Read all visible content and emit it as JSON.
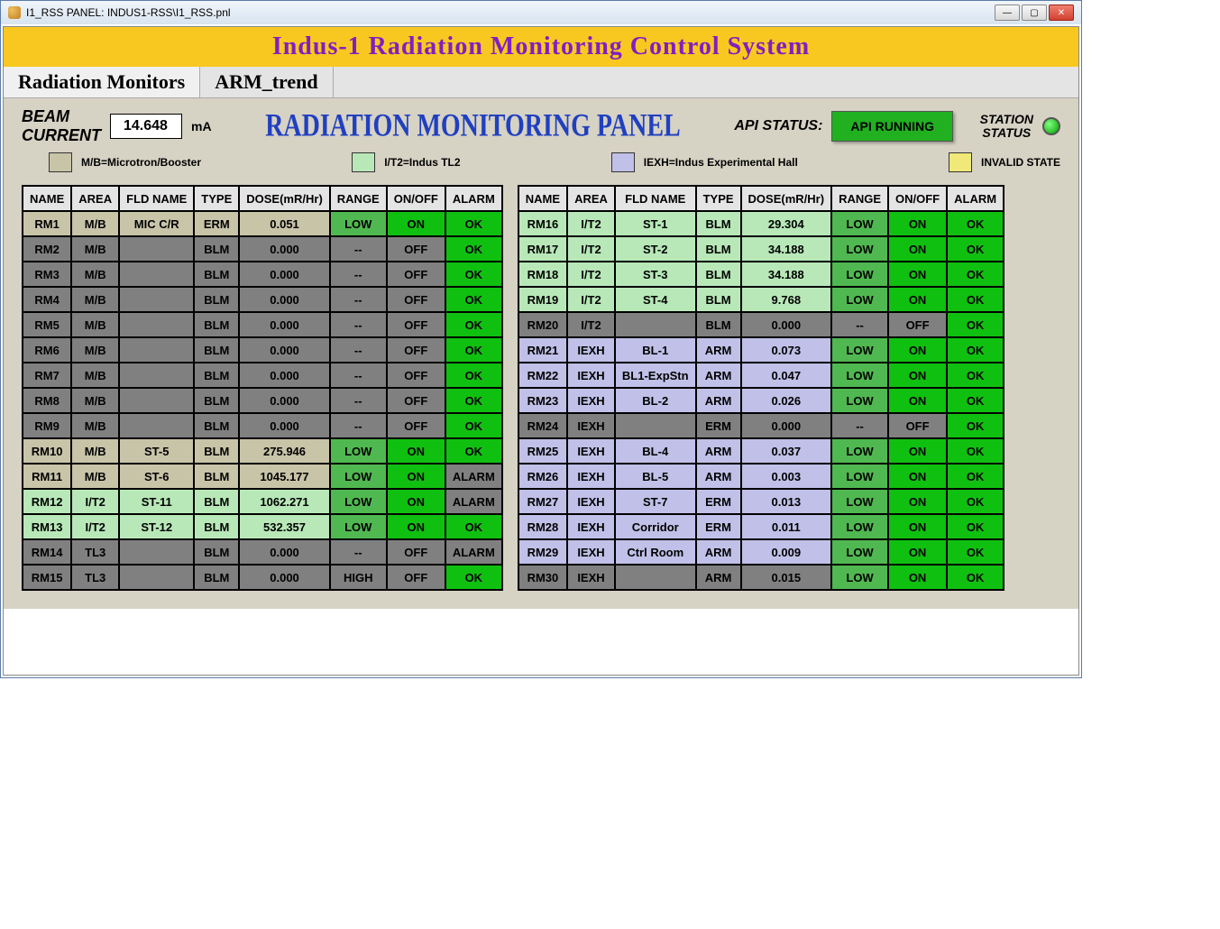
{
  "window": {
    "title": "I1_RSS PANEL: INDUS1-RSS\\I1_RSS.pnl"
  },
  "banner": "Indus-1 Radiation Monitoring Control System",
  "tabs": {
    "t0": "Radiation Monitors",
    "t1": "ARM_trend"
  },
  "top": {
    "beam_label_1": "BEAM",
    "beam_label_2": "CURRENT",
    "beam_value": "14.648",
    "beam_unit": "mA",
    "panel_title": "RADIATION MONITORING PANEL",
    "api_label": "API  STATUS:",
    "api_value": "API RUNNING",
    "station_label_1": "STATION",
    "station_label_2": "STATUS"
  },
  "legend": {
    "mb": "M/B=Microtron/Booster",
    "it2": "I/T2=Indus TL2",
    "iexh": "IEXH=Indus Experimental Hall",
    "invalid": "INVALID STATE"
  },
  "headers": {
    "name": "NAME",
    "area": "AREA",
    "fld": "FLD NAME",
    "type": "TYPE",
    "dose": "DOSE(mR/Hr)",
    "range": "RANGE",
    "onoff": "ON/OFF",
    "alarm": "ALARM"
  },
  "left": [
    {
      "name": "RM1",
      "area": "M/B",
      "ac": "mb",
      "fld": "MIC C/R",
      "type": "ERM",
      "dose": "0.051",
      "range": "LOW",
      "onoff": "ON",
      "alarm": "OK"
    },
    {
      "name": "RM2",
      "area": "M/B",
      "ac": "mb",
      "fld": "",
      "type": "BLM",
      "dose": "0.000",
      "range": "--",
      "onoff": "OFF",
      "alarm": "OK"
    },
    {
      "name": "RM3",
      "area": "M/B",
      "ac": "mb",
      "fld": "",
      "type": "BLM",
      "dose": "0.000",
      "range": "--",
      "onoff": "OFF",
      "alarm": "OK"
    },
    {
      "name": "RM4",
      "area": "M/B",
      "ac": "mb",
      "fld": "",
      "type": "BLM",
      "dose": "0.000",
      "range": "--",
      "onoff": "OFF",
      "alarm": "OK"
    },
    {
      "name": "RM5",
      "area": "M/B",
      "ac": "mb",
      "fld": "",
      "type": "BLM",
      "dose": "0.000",
      "range": "--",
      "onoff": "OFF",
      "alarm": "OK"
    },
    {
      "name": "RM6",
      "area": "M/B",
      "ac": "mb",
      "fld": "",
      "type": "BLM",
      "dose": "0.000",
      "range": "--",
      "onoff": "OFF",
      "alarm": "OK"
    },
    {
      "name": "RM7",
      "area": "M/B",
      "ac": "mb",
      "fld": "",
      "type": "BLM",
      "dose": "0.000",
      "range": "--",
      "onoff": "OFF",
      "alarm": "OK"
    },
    {
      "name": "RM8",
      "area": "M/B",
      "ac": "mb",
      "fld": "",
      "type": "BLM",
      "dose": "0.000",
      "range": "--",
      "onoff": "OFF",
      "alarm": "OK"
    },
    {
      "name": "RM9",
      "area": "M/B",
      "ac": "mb",
      "fld": "",
      "type": "BLM",
      "dose": "0.000",
      "range": "--",
      "onoff": "OFF",
      "alarm": "OK"
    },
    {
      "name": "RM10",
      "area": "M/B",
      "ac": "mb",
      "fld": "ST-5",
      "type": "BLM",
      "dose": "275.946",
      "range": "LOW",
      "onoff": "ON",
      "alarm": "OK"
    },
    {
      "name": "RM11",
      "area": "M/B",
      "ac": "mb",
      "fld": "ST-6",
      "type": "BLM",
      "dose": "1045.177",
      "range": "LOW",
      "onoff": "ON",
      "alarm": "ALARM"
    },
    {
      "name": "RM12",
      "area": "I/T2",
      "ac": "it2",
      "fld": "ST-11",
      "type": "BLM",
      "dose": "1062.271",
      "range": "LOW",
      "onoff": "ON",
      "alarm": "ALARM"
    },
    {
      "name": "RM13",
      "area": "I/T2",
      "ac": "it2",
      "fld": "ST-12",
      "type": "BLM",
      "dose": "532.357",
      "range": "LOW",
      "onoff": "ON",
      "alarm": "OK"
    },
    {
      "name": "RM14",
      "area": "TL3",
      "ac": "gray",
      "fld": "",
      "type": "BLM",
      "dose": "0.000",
      "range": "--",
      "onoff": "OFF",
      "alarm": "ALARM"
    },
    {
      "name": "RM15",
      "area": "TL3",
      "ac": "gray",
      "fld": "",
      "type": "BLM",
      "dose": "0.000",
      "range": "HIGH",
      "onoff": "OFF",
      "alarm": "OK"
    }
  ],
  "right": [
    {
      "name": "RM16",
      "area": "I/T2",
      "ac": "it2",
      "fld": "ST-1",
      "type": "BLM",
      "dose": "29.304",
      "range": "LOW",
      "onoff": "ON",
      "alarm": "OK"
    },
    {
      "name": "RM17",
      "area": "I/T2",
      "ac": "it2",
      "fld": "ST-2",
      "type": "BLM",
      "dose": "34.188",
      "range": "LOW",
      "onoff": "ON",
      "alarm": "OK"
    },
    {
      "name": "RM18",
      "area": "I/T2",
      "ac": "it2",
      "fld": "ST-3",
      "type": "BLM",
      "dose": "34.188",
      "range": "LOW",
      "onoff": "ON",
      "alarm": "OK"
    },
    {
      "name": "RM19",
      "area": "I/T2",
      "ac": "it2",
      "fld": "ST-4",
      "type": "BLM",
      "dose": "9.768",
      "range": "LOW",
      "onoff": "ON",
      "alarm": "OK"
    },
    {
      "name": "RM20",
      "area": "I/T2",
      "ac": "it2",
      "fld": "",
      "type": "BLM",
      "dose": "0.000",
      "range": "--",
      "onoff": "OFF",
      "alarm": "OK"
    },
    {
      "name": "RM21",
      "area": "IEXH",
      "ac": "iexh",
      "fld": "BL-1",
      "type": "ARM",
      "dose": "0.073",
      "range": "LOW",
      "onoff": "ON",
      "alarm": "OK"
    },
    {
      "name": "RM22",
      "area": "IEXH",
      "ac": "iexh",
      "fld": "BL1-ExpStn",
      "type": "ARM",
      "dose": "0.047",
      "range": "LOW",
      "onoff": "ON",
      "alarm": "OK"
    },
    {
      "name": "RM23",
      "area": "IEXH",
      "ac": "iexh",
      "fld": "BL-2",
      "type": "ARM",
      "dose": "0.026",
      "range": "LOW",
      "onoff": "ON",
      "alarm": "OK"
    },
    {
      "name": "RM24",
      "area": "IEXH",
      "ac": "iexh",
      "fld": "",
      "type": "ERM",
      "dose": "0.000",
      "range": "--",
      "onoff": "OFF",
      "alarm": "OK"
    },
    {
      "name": "RM25",
      "area": "IEXH",
      "ac": "iexh",
      "fld": "BL-4",
      "type": "ARM",
      "dose": "0.037",
      "range": "LOW",
      "onoff": "ON",
      "alarm": "OK"
    },
    {
      "name": "RM26",
      "area": "IEXH",
      "ac": "iexh",
      "fld": "BL-5",
      "type": "ARM",
      "dose": "0.003",
      "range": "LOW",
      "onoff": "ON",
      "alarm": "OK"
    },
    {
      "name": "RM27",
      "area": "IEXH",
      "ac": "iexh",
      "fld": "ST-7",
      "type": "ERM",
      "dose": "0.013",
      "range": "LOW",
      "onoff": "ON",
      "alarm": "OK"
    },
    {
      "name": "RM28",
      "area": "IEXH",
      "ac": "iexh",
      "fld": "Corridor",
      "type": "ERM",
      "dose": "0.011",
      "range": "LOW",
      "onoff": "ON",
      "alarm": "OK"
    },
    {
      "name": "RM29",
      "area": "IEXH",
      "ac": "iexh",
      "fld": "Ctrl Room",
      "type": "ARM",
      "dose": "0.009",
      "range": "LOW",
      "onoff": "ON",
      "alarm": "OK"
    },
    {
      "name": "RM30",
      "area": "IEXH",
      "ac": "iexh",
      "fld": "",
      "type": "ARM",
      "dose": "0.015",
      "range": "LOW",
      "onoff": "ON",
      "alarm": "OK"
    }
  ]
}
